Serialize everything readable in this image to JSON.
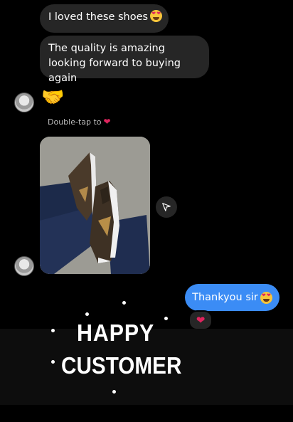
{
  "messages": {
    "incoming_1": "I loved these shoes",
    "incoming_2": "The quality is amazing looking forward to buying again",
    "reaction_hint": "Double-tap to",
    "outgoing_1": "Thankyou sir"
  },
  "overlay": {
    "line1": "HAPPY",
    "line2": "CUSTOMER"
  },
  "icons": {
    "heart_eyes": "smiling-face-with-heart-eyes-icon",
    "handshake": "handshake-icon",
    "heart": "heart-icon",
    "share": "send-icon"
  },
  "colors": {
    "background": "#000000",
    "incoming_bubble": "#262626",
    "outgoing_bubble": "#3b8cf5",
    "heart": "#e0245e"
  }
}
